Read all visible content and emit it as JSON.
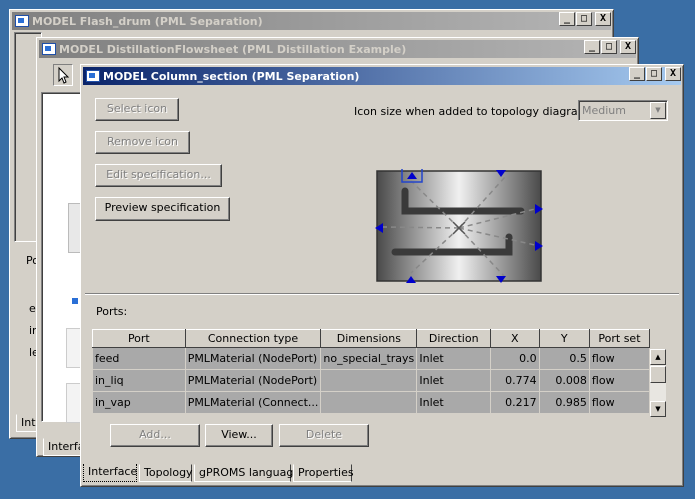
{
  "windows": {
    "back": {
      "title": "MODEL Flash_drum (PML Separation)",
      "tab_fragment": "Inte",
      "side_labels": [
        "Po",
        "en",
        "in",
        "le"
      ]
    },
    "middle": {
      "title": "MODEL DistillationFlowsheet (PML Distillation Example)",
      "tab_fragment": "Interfa"
    },
    "front": {
      "title": "MODEL Column_section (PML Separation)"
    }
  },
  "title_buttons": {
    "minimize": "_",
    "maximize": "□",
    "close": "X"
  },
  "icon_panel": {
    "select_icon": "Select icon",
    "remove_icon": "Remove icon",
    "edit_spec": "Edit specification...",
    "preview_spec": "Preview specification",
    "size_label": "Icon size when added to topology diagrams:",
    "size_value": "Medium"
  },
  "ports": {
    "label": "Ports:",
    "columns": [
      "Port",
      "Connection type",
      "Dimensions",
      "Direction",
      "X",
      "Y",
      "Port set"
    ],
    "rows": [
      [
        "feed",
        "PMLMaterial (NodePort)",
        "no_special_trays",
        "Inlet",
        "0.0",
        "0.5",
        "flow"
      ],
      [
        "in_liq",
        "PMLMaterial (NodePort)",
        "",
        "Inlet",
        "0.774",
        "0.008",
        "flow"
      ],
      [
        "in_vap",
        "PMLMaterial (Connect...",
        "",
        "Inlet",
        "0.217",
        "0.985",
        "flow"
      ]
    ],
    "add": "Add...",
    "view": "View...",
    "delete": "Delete"
  },
  "tabs": [
    "Interface",
    "Topology",
    "gPROMS language",
    "Properties"
  ],
  "colors": {
    "desktop": "#3a6ea5",
    "active_title": "#0a246a",
    "port_marker": "#0000cc"
  },
  "icons": [
    "window-icon",
    "cursor-arrow-icon",
    "dropdown-arrow-icon",
    "scroll-up-icon",
    "scroll-down-icon"
  ]
}
